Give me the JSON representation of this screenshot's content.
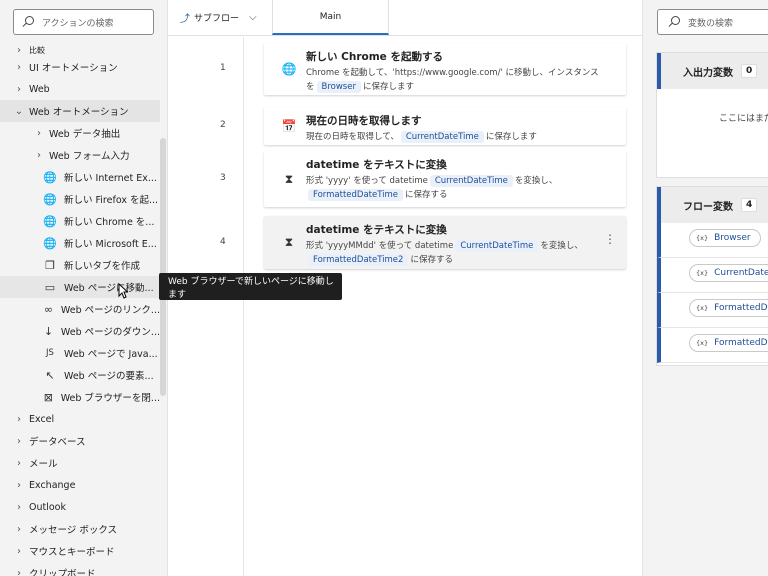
{
  "actions_pane": {
    "search_placeholder": "アクションの検索",
    "items": [
      {
        "label": "比較",
        "kind": "cut"
      },
      {
        "label": "UI オートメーション",
        "kind": "group"
      },
      {
        "label": "Web",
        "kind": "group"
      },
      {
        "label": "Web オートメーション",
        "kind": "group-expanded"
      },
      {
        "label": "Web データ抽出",
        "kind": "subgroup"
      },
      {
        "label": "Web フォーム入力",
        "kind": "subgroup"
      },
      {
        "label": "新しい Internet Ex...",
        "kind": "leaf",
        "icon": "globe-icon"
      },
      {
        "label": "新しい Firefox を起...",
        "kind": "leaf",
        "icon": "globe-icon"
      },
      {
        "label": "新しい Chrome を...",
        "kind": "leaf",
        "icon": "globe-icon"
      },
      {
        "label": "新しい Microsoft E...",
        "kind": "leaf",
        "icon": "globe-icon"
      },
      {
        "label": "新しいタブを作成",
        "kind": "leaf",
        "icon": "new-tab-icon"
      },
      {
        "label": "Web ページに移動...",
        "kind": "leaf-hover",
        "icon": "browser-window-icon"
      },
      {
        "label": "Web ページのリンク...",
        "kind": "leaf",
        "icon": "link-icon"
      },
      {
        "label": "Web ページのダウン...",
        "kind": "leaf",
        "icon": "download-icon"
      },
      {
        "label": "Web ページで Java...",
        "kind": "leaf",
        "icon": "javascript-icon"
      },
      {
        "label": "Web ページの要素...",
        "kind": "leaf",
        "icon": "pointer-icon"
      },
      {
        "label": "Web ブラウザーを閉...",
        "kind": "leaf",
        "icon": "close-box-icon"
      },
      {
        "label": "Excel",
        "kind": "group"
      },
      {
        "label": "データベース",
        "kind": "group"
      },
      {
        "label": "メール",
        "kind": "group"
      },
      {
        "label": "Exchange",
        "kind": "group"
      },
      {
        "label": "Outlook",
        "kind": "group"
      },
      {
        "label": "メッセージ ボックス",
        "kind": "group"
      },
      {
        "label": "マウスとキーボード",
        "kind": "group"
      },
      {
        "label": "クリップボード",
        "kind": "group"
      }
    ],
    "tooltip": "Web ブラウザーで新しいページに移動します"
  },
  "tabs": {
    "subflow_label": "サブフロー",
    "main_label": "Main"
  },
  "steps": [
    {
      "num": "1",
      "icon": "globe-icon",
      "title": "新しい Chrome を起動する",
      "desc1a": "Chrome を起動して、'https://www.google.com/' に移動し、インスタンス",
      "desc2a": "を",
      "var1": "Browser",
      "desc2b": "に保存します"
    },
    {
      "num": "2",
      "icon": "calendar-icon",
      "title": "現在の日時を取得します",
      "desc1a": "現在の日時を取得して、",
      "var1": "CurrentDateTime",
      "desc1b": "に保存します"
    },
    {
      "num": "3",
      "icon": "hourglass-icon",
      "title": "datetime をテキストに変換",
      "desc1a": "形式 'yyyy' を使って datetime",
      "var1": "CurrentDateTime",
      "desc1b": "を変換し、",
      "var2": "FormattedDateTime",
      "desc2b": "に保存する"
    },
    {
      "num": "4",
      "icon": "hourglass-icon",
      "title": "datetime をテキストに変換",
      "desc1a": "形式 'yyyyMMdd' を使って datetime",
      "var1": "CurrentDateTime",
      "desc1b": "を変換し、",
      "var2": "FormattedDateTime2",
      "desc2b": "に保存する"
    }
  ],
  "variables_pane": {
    "search_placeholder": "変数の検索",
    "io_title": "入出力変数",
    "io_count": "0",
    "io_empty": "ここにはまだ",
    "flow_title": "フロー変数",
    "flow_count": "4",
    "flow_vars": [
      "Browser",
      "CurrentDateTi",
      "FormattedDa",
      "FormattedDa"
    ],
    "var_prefix": "{x}"
  },
  "colors": {
    "accent": "#2b5aa8",
    "chip_bg": "#e9f0fa",
    "chip_text": "#1f4e96",
    "tooltip_bg": "#1f1f1f"
  }
}
